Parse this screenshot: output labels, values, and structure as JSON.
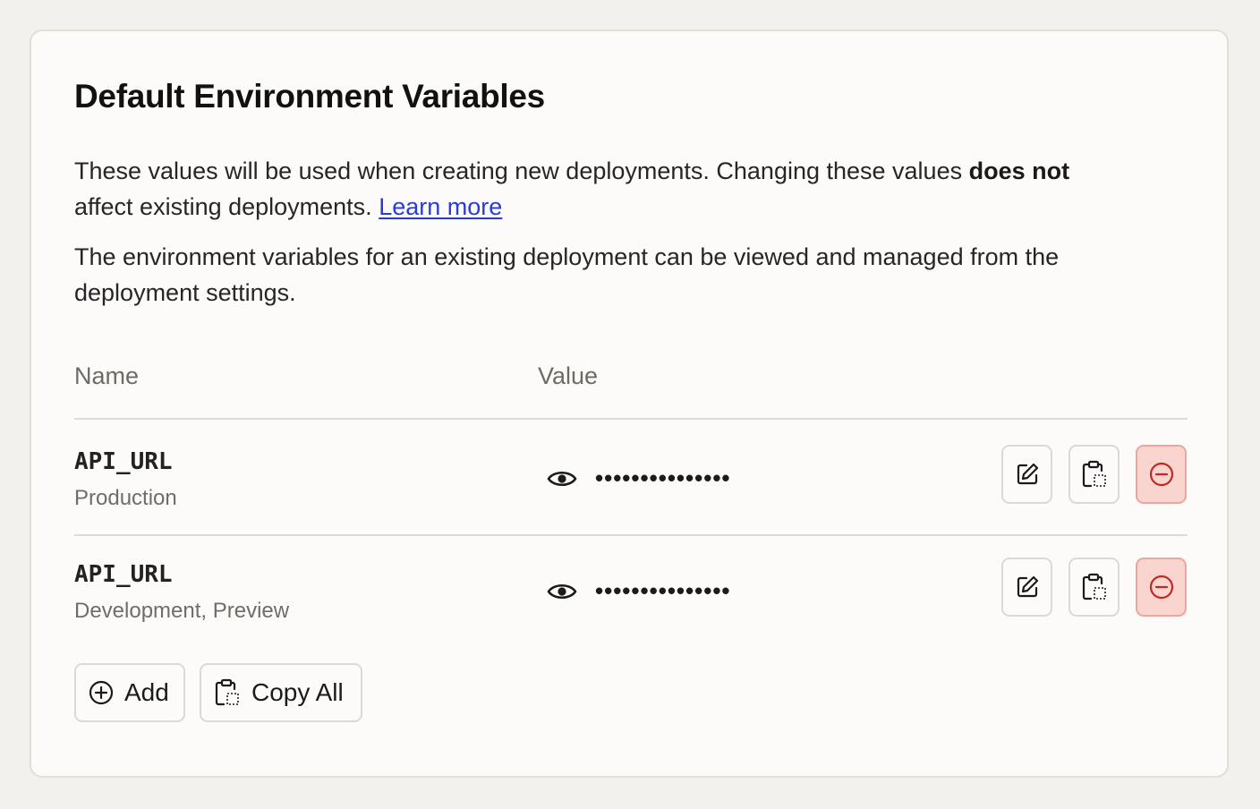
{
  "section": {
    "title": "Default Environment Variables",
    "desc1_part1": "These values will be used when creating new deployments. Changing these values ",
    "desc1_bold": "does not",
    "desc1_part2": " affect existing deployments. ",
    "learn_more": "Learn more",
    "desc2": "The environment variables for an existing deployment can be viewed and managed from the deployment settings."
  },
  "table": {
    "headers": {
      "name": "Name",
      "value": "Value"
    },
    "rows": [
      {
        "name": "API_URL",
        "environments": "Production",
        "masked_value": "•••••••••••••••"
      },
      {
        "name": "API_URL",
        "environments": "Development, Preview",
        "masked_value": "•••••••••••••••"
      }
    ]
  },
  "actions": {
    "add_label": "Add",
    "copy_all_label": "Copy All"
  },
  "icons": {
    "reveal": "eye-icon",
    "edit": "edit-icon",
    "copy": "clipboard-icon",
    "remove": "minus-circle-icon",
    "add": "plus-circle-icon"
  },
  "colors": {
    "link": "#2b3bd6",
    "danger_bg": "#fad4cf",
    "danger_icon": "#c22a1f",
    "page_bg": "#f3f1ee",
    "card_bg": "#fcfbfa"
  }
}
